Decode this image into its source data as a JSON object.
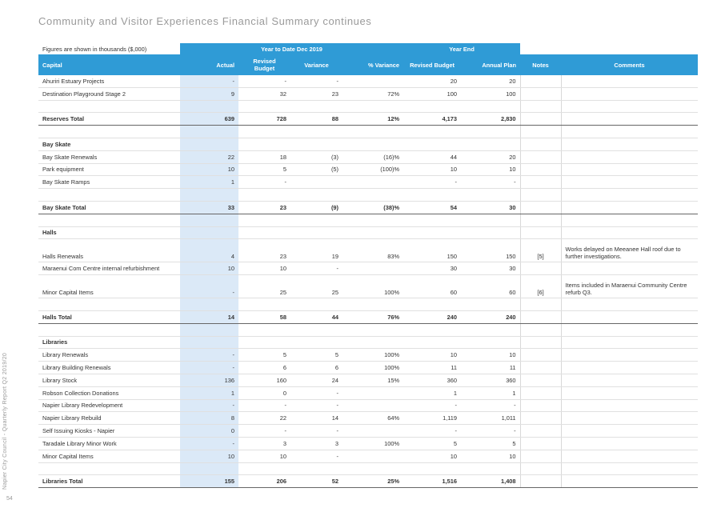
{
  "page": {
    "title": "Community and Visitor Experiences Financial Summary continues",
    "side_text": "Napier City Council - Quarterly Report Q2 2019/20",
    "page_number": "54"
  },
  "table": {
    "figures_note": "Figures are shown in thousands ($,000)",
    "group_ytd": "Year to Date Dec 2019",
    "group_ye": "Year End",
    "headers": {
      "capital": "Capital",
      "actual": "Actual",
      "revised_budget": "Revised Budget",
      "variance": "Variance",
      "pct_variance": "% Variance",
      "ye_revised_budget": "Revised Budget",
      "annual_plan": "Annual Plan",
      "notes": "Notes",
      "comments": "Comments"
    },
    "rows": [
      {
        "type": "data",
        "label": "Ahuriri Estuary Projects",
        "actual": "-",
        "budget": "-",
        "variance": "-",
        "pct": "",
        "ye_budget": "20",
        "plan": "20",
        "notes": "",
        "comments": ""
      },
      {
        "type": "data",
        "label": "Destination Playground Stage 2",
        "actual": "9",
        "budget": "32",
        "variance": "23",
        "pct": "72%",
        "ye_budget": "100",
        "plan": "100",
        "notes": "",
        "comments": ""
      },
      {
        "type": "spacer"
      },
      {
        "type": "total",
        "label": "Reserves Total",
        "actual": "639",
        "budget": "728",
        "variance": "88",
        "pct": "12%",
        "ye_budget": "4,173",
        "plan": "2,830",
        "notes": "",
        "comments": ""
      },
      {
        "type": "spacer"
      },
      {
        "type": "section",
        "label": "Bay Skate"
      },
      {
        "type": "data",
        "label": "Bay Skate Renewals",
        "actual": "22",
        "budget": "18",
        "variance": "(3)",
        "pct": "(16)%",
        "ye_budget": "44",
        "plan": "20",
        "notes": "",
        "comments": ""
      },
      {
        "type": "data",
        "label": "Park equipment",
        "actual": "10",
        "budget": "5",
        "variance": "(5)",
        "pct": "(100)%",
        "ye_budget": "10",
        "plan": "10",
        "notes": "",
        "comments": ""
      },
      {
        "type": "data",
        "label": "Bay Skate Ramps",
        "actual": "1",
        "budget": "-",
        "variance": "",
        "pct": "",
        "ye_budget": "-",
        "plan": "-",
        "notes": "",
        "comments": ""
      },
      {
        "type": "spacer"
      },
      {
        "type": "total",
        "label": "Bay Skate Total",
        "actual": "33",
        "budget": "23",
        "variance": "(9)",
        "pct": "(38)%",
        "ye_budget": "54",
        "plan": "30",
        "notes": "",
        "comments": ""
      },
      {
        "type": "spacer"
      },
      {
        "type": "section",
        "label": "Halls"
      },
      {
        "type": "tall",
        "label": "Halls Renewals",
        "actual": "4",
        "budget": "23",
        "variance": "19",
        "pct": "83%",
        "ye_budget": "150",
        "plan": "150",
        "notes": "[5]",
        "comments": "Works delayed on Meeanee Hall roof due to further investigations."
      },
      {
        "type": "data",
        "label": "Maraenui Com Centre internal refurbishment",
        "actual": "10",
        "budget": "10",
        "variance": "-",
        "pct": "",
        "ye_budget": "30",
        "plan": "30",
        "notes": "",
        "comments": ""
      },
      {
        "type": "tall",
        "label": "Minor Capital Items",
        "actual": "-",
        "budget": "25",
        "variance": "25",
        "pct": "100%",
        "ye_budget": "60",
        "plan": "60",
        "notes": "[6]",
        "comments": "Items included in Maraenui Community Centre refurb Q3."
      },
      {
        "type": "spacer"
      },
      {
        "type": "total",
        "label": "Halls Total",
        "actual": "14",
        "budget": "58",
        "variance": "44",
        "pct": "76%",
        "ye_budget": "240",
        "plan": "240",
        "notes": "",
        "comments": ""
      },
      {
        "type": "spacer"
      },
      {
        "type": "section",
        "label": "Libraries"
      },
      {
        "type": "data",
        "label": "Library Renewals",
        "actual": "-",
        "budget": "5",
        "variance": "5",
        "pct": "100%",
        "ye_budget": "10",
        "plan": "10",
        "notes": "",
        "comments": ""
      },
      {
        "type": "data",
        "label": "Library Building Renewals",
        "actual": "-",
        "budget": "6",
        "variance": "6",
        "pct": "100%",
        "ye_budget": "11",
        "plan": "11",
        "notes": "",
        "comments": ""
      },
      {
        "type": "data",
        "label": "Library Stock",
        "actual": "136",
        "budget": "160",
        "variance": "24",
        "pct": "15%",
        "ye_budget": "360",
        "plan": "360",
        "notes": "",
        "comments": ""
      },
      {
        "type": "data",
        "label": "Robson Collection Donations",
        "actual": "1",
        "budget": "0",
        "variance": "-",
        "pct": "",
        "ye_budget": "1",
        "plan": "1",
        "notes": "",
        "comments": ""
      },
      {
        "type": "data",
        "label": "Napier Library Redevelopment",
        "actual": "-",
        "budget": "-",
        "variance": "-",
        "pct": "",
        "ye_budget": "-",
        "plan": "-",
        "notes": "",
        "comments": ""
      },
      {
        "type": "data",
        "label": "Napier Library Rebuild",
        "actual": "8",
        "budget": "22",
        "variance": "14",
        "pct": "64%",
        "ye_budget": "1,119",
        "plan": "1,011",
        "notes": "",
        "comments": ""
      },
      {
        "type": "data",
        "label": "Self Issuing Kiosks - Napier",
        "actual": "0",
        "budget": "-",
        "variance": "-",
        "pct": "",
        "ye_budget": "-",
        "plan": "-",
        "notes": "",
        "comments": ""
      },
      {
        "type": "data",
        "label": "Taradale Library Minor Work",
        "actual": "-",
        "budget": "3",
        "variance": "3",
        "pct": "100%",
        "ye_budget": "5",
        "plan": "5",
        "notes": "",
        "comments": ""
      },
      {
        "type": "data",
        "label": "Minor Capital Items",
        "actual": "10",
        "budget": "10",
        "variance": "-",
        "pct": "",
        "ye_budget": "10",
        "plan": "10",
        "notes": "",
        "comments": ""
      },
      {
        "type": "spacer"
      },
      {
        "type": "total",
        "label": "Libraries Total",
        "actual": "155",
        "budget": "206",
        "variance": "52",
        "pct": "25%",
        "ye_budget": "1,516",
        "plan": "1,408",
        "notes": "",
        "comments": ""
      }
    ]
  },
  "colors": {
    "header_blue": "#2f9bd6",
    "actual_col": "#dbe9f7"
  }
}
